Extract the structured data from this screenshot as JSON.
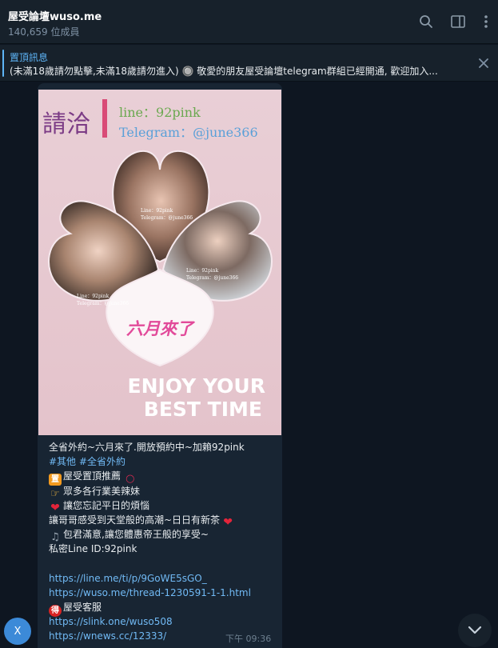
{
  "header": {
    "title": "屋受論壇wuso.me",
    "members": "140,659 位成員",
    "icons": [
      "search-icon",
      "sidebar-toggle-icon",
      "more-vertical-icon"
    ]
  },
  "pinned": {
    "label": "置頂訊息",
    "text": "(未滿18歲請勿點擊,未滿18歲請勿進入) 🔘 敬愛的朋友屋受論壇telegram群組已經開通, 歡迎加入..."
  },
  "poster": {
    "logo_text": "請洽",
    "line_contact": "line：92pink",
    "telegram_contact": "Telegram：@june366",
    "tagline": "六月來了",
    "slogan_line1": "ENJOY YOUR",
    "slogan_line2": "BEST TIME",
    "watermark_line": "Line：92pink",
    "watermark_tg": "Telegram：@june366"
  },
  "message": {
    "line1": "全省外約~六月來了.開放預約中~加賴92pink",
    "tag1": "#其他",
    "tag2": "#全省外約",
    "badge1": "置",
    "line3": "屋受置頂推薦",
    "line4": "眾多各行業美辣妹",
    "line5": "讓您忘記平日的煩惱",
    "line6": "讓哥哥感受到天堂般的高潮~日日有新茶",
    "line7": "包君滿意,讓您體惠帝王般的享受~",
    "line8": "私密Line ID:92pink",
    "link1": "https://line.me/ti/p/9GoWE5sGO_",
    "link2": "https://wuso.me/thread-1230591-1-1.html",
    "badge2": "得",
    "line11": "屋受客服",
    "link3": "https://slink.one/wuso508",
    "link4": "https://wnews.cc/12333/",
    "time": "下午 09:36"
  },
  "avatar_letter": "X",
  "colors": {
    "background": "#0e1621",
    "header": "#17212b",
    "bubble": "#182533",
    "accent": "#5eb5f7",
    "link": "#71baf5"
  }
}
